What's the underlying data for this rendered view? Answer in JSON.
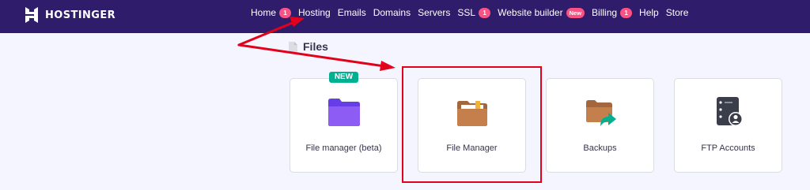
{
  "brand": {
    "name": "HOSTINGER"
  },
  "nav": [
    {
      "label": "Home",
      "badge": "1"
    },
    {
      "label": "Hosting"
    },
    {
      "label": "Emails"
    },
    {
      "label": "Domains"
    },
    {
      "label": "Servers"
    },
    {
      "label": "SSL",
      "badge": "1"
    },
    {
      "label": "Website builder",
      "badge": "New"
    },
    {
      "label": "Billing",
      "badge": "1"
    },
    {
      "label": "Help"
    },
    {
      "label": "Store"
    }
  ],
  "section": {
    "title": "Files",
    "icon": "document-icon"
  },
  "cards": [
    {
      "label": "File manager (beta)",
      "tag": "NEW",
      "icon": "purple-folder-icon"
    },
    {
      "label": "File Manager",
      "icon": "brown-folder-icon"
    },
    {
      "label": "Backups",
      "icon": "folder-arrow-icon"
    },
    {
      "label": "FTP Accounts",
      "icon": "ftp-server-icon"
    }
  ],
  "colors": {
    "topbar": "#2f1c6a",
    "badge": "#fc5185",
    "new_tag": "#00b090",
    "annotation": "#e3001b",
    "background": "#f4f5ff"
  }
}
